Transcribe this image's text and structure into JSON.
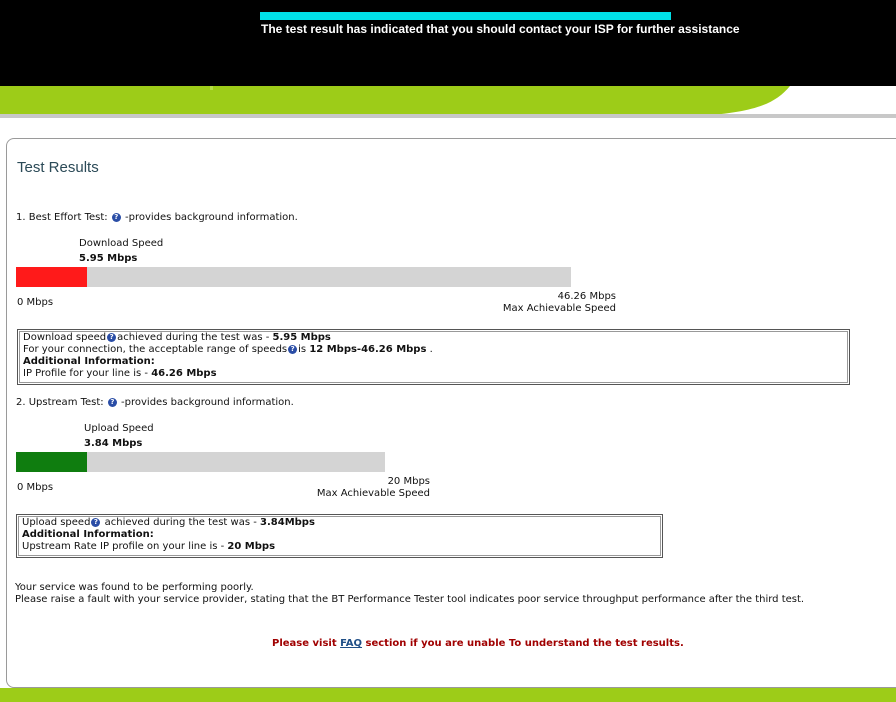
{
  "banner": {
    "message": "The test result has indicated that you should contact your ISP for further assistance"
  },
  "colors": {
    "accent_green": "#9dcc18",
    "download_bar": "#ff1a1a",
    "upload_bar": "#0f7d0f",
    "track": "#d4d4d4",
    "faq_text": "#a00000"
  },
  "page": {
    "title": "Test Results"
  },
  "best_effort": {
    "heading_prefix": "1. Best Effort Test:",
    "heading_suffix": "-provides background information.",
    "help_icon": "question-circle-icon",
    "speed_label": "Download Speed",
    "speed_value": "5.95 Mbps",
    "fill_fraction": 0.1286,
    "min_label": "0 Mbps",
    "max_value": "46.26 Mbps",
    "max_label": "Max Achievable Speed",
    "info": {
      "line1_text": "Download speed",
      "line1_mid": "achieved during the test was - ",
      "line1_value": "5.95 Mbps",
      "line2_text": "For your connection, the acceptable range of speeds",
      "line2_mid": "is ",
      "line2_value": "12 Mbps-46.26 Mbps",
      "line2_end": " .",
      "additional_heading": "Additional Information:",
      "line3_text": "IP Profile for your line is - ",
      "line3_value": "46.26 Mbps"
    }
  },
  "upstream": {
    "heading_prefix": "2. Upstream Test:",
    "heading_suffix": "-provides background information.",
    "help_icon": "question-circle-icon",
    "speed_label": "Upload Speed",
    "speed_value": "3.84 Mbps",
    "fill_fraction": 0.192,
    "min_label": "0 Mbps",
    "max_value": "20 Mbps",
    "max_label": "Max Achievable Speed",
    "info": {
      "line1_text": "Upload speed",
      "line1_mid": " achieved during the test was - ",
      "line1_value": "3.84Mbps",
      "additional_heading": "Additional Information:",
      "line2_text": "Upstream Rate IP profile on your line is - ",
      "line2_value": "20 Mbps"
    }
  },
  "summary": {
    "line1": "Your service was found to be performing poorly.",
    "line2": "Please raise a fault with your service provider, stating that the BT Performance Tester tool indicates poor service throughput performance after the third test."
  },
  "faq": {
    "prefix": "Please visit ",
    "link": "FAQ",
    "suffix": " section if you are unable To understand the test results."
  }
}
